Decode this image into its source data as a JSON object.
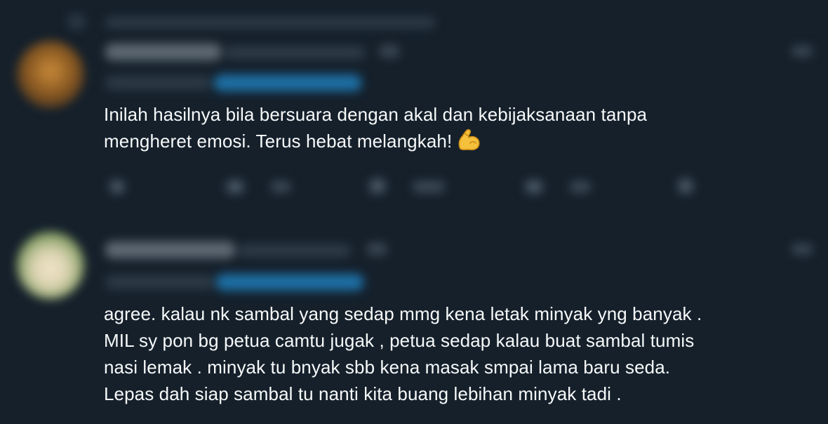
{
  "colors": {
    "background": "#15202b",
    "text": "#f7f9f9",
    "blurred_grey": "#3e4b57",
    "blurred_link": "#1d6fa5"
  },
  "tweets": [
    {
      "author_name": "",
      "handle": "",
      "text_lines": [
        "Inilah hasilnya bila bersuara dengan akal dan kebijaksanaan tanpa",
        "mengheret emosi. Terus hebat melangkah!"
      ],
      "emoji": "flexed-biceps"
    },
    {
      "author_name": "",
      "handle": "",
      "text_lines": [
        "agree. kalau nk sambal yang sedap mmg kena letak minyak yng banyak .",
        "MIL sy pon bg petua camtu jugak , petua sedap kalau buat sambal tumis",
        "nasi lemak . minyak tu bnyak sbb kena masak smpai lama baru seda.",
        "Lepas dah siap sambal tu nanti kita buang lebihan minyak tadi ."
      ]
    }
  ]
}
